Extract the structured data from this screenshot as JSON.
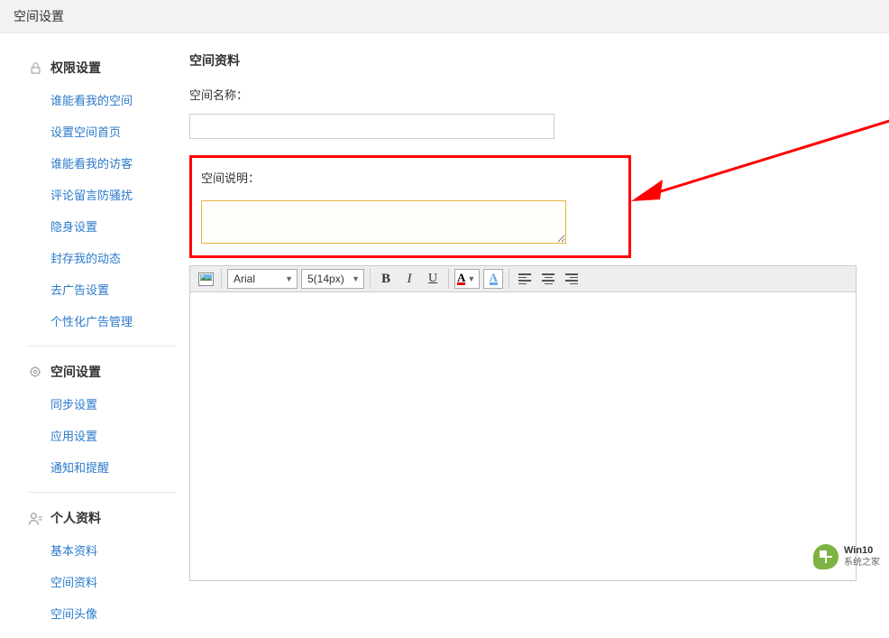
{
  "header": {
    "title": "空间设置"
  },
  "sidebar": {
    "sections": [
      {
        "icon": "lock-icon",
        "title": "权限设置",
        "items": [
          {
            "label": "谁能看我的空间"
          },
          {
            "label": "设置空间首页"
          },
          {
            "label": "谁能看我的访客"
          },
          {
            "label": "评论留言防骚扰"
          },
          {
            "label": "隐身设置"
          },
          {
            "label": "封存我的动态"
          },
          {
            "label": "去广告设置"
          },
          {
            "label": "个性化广告管理"
          }
        ]
      },
      {
        "icon": "gear-icon",
        "title": "空间设置",
        "items": [
          {
            "label": "同步设置"
          },
          {
            "label": "应用设置"
          },
          {
            "label": "通知和提醒"
          }
        ]
      },
      {
        "icon": "person-icon",
        "title": "个人资料",
        "items": [
          {
            "label": "基本资料"
          },
          {
            "label": "空间资料"
          },
          {
            "label": "空间头像"
          }
        ]
      }
    ]
  },
  "main": {
    "section_title": "空间资料",
    "name_label": "空间名称：",
    "desc_label": "空间说明：",
    "name_value": "",
    "desc_value": ""
  },
  "editor": {
    "font": "Arial",
    "size": "5(14px)"
  },
  "watermark": {
    "line1": "Win10",
    "line2": "系统之家"
  }
}
